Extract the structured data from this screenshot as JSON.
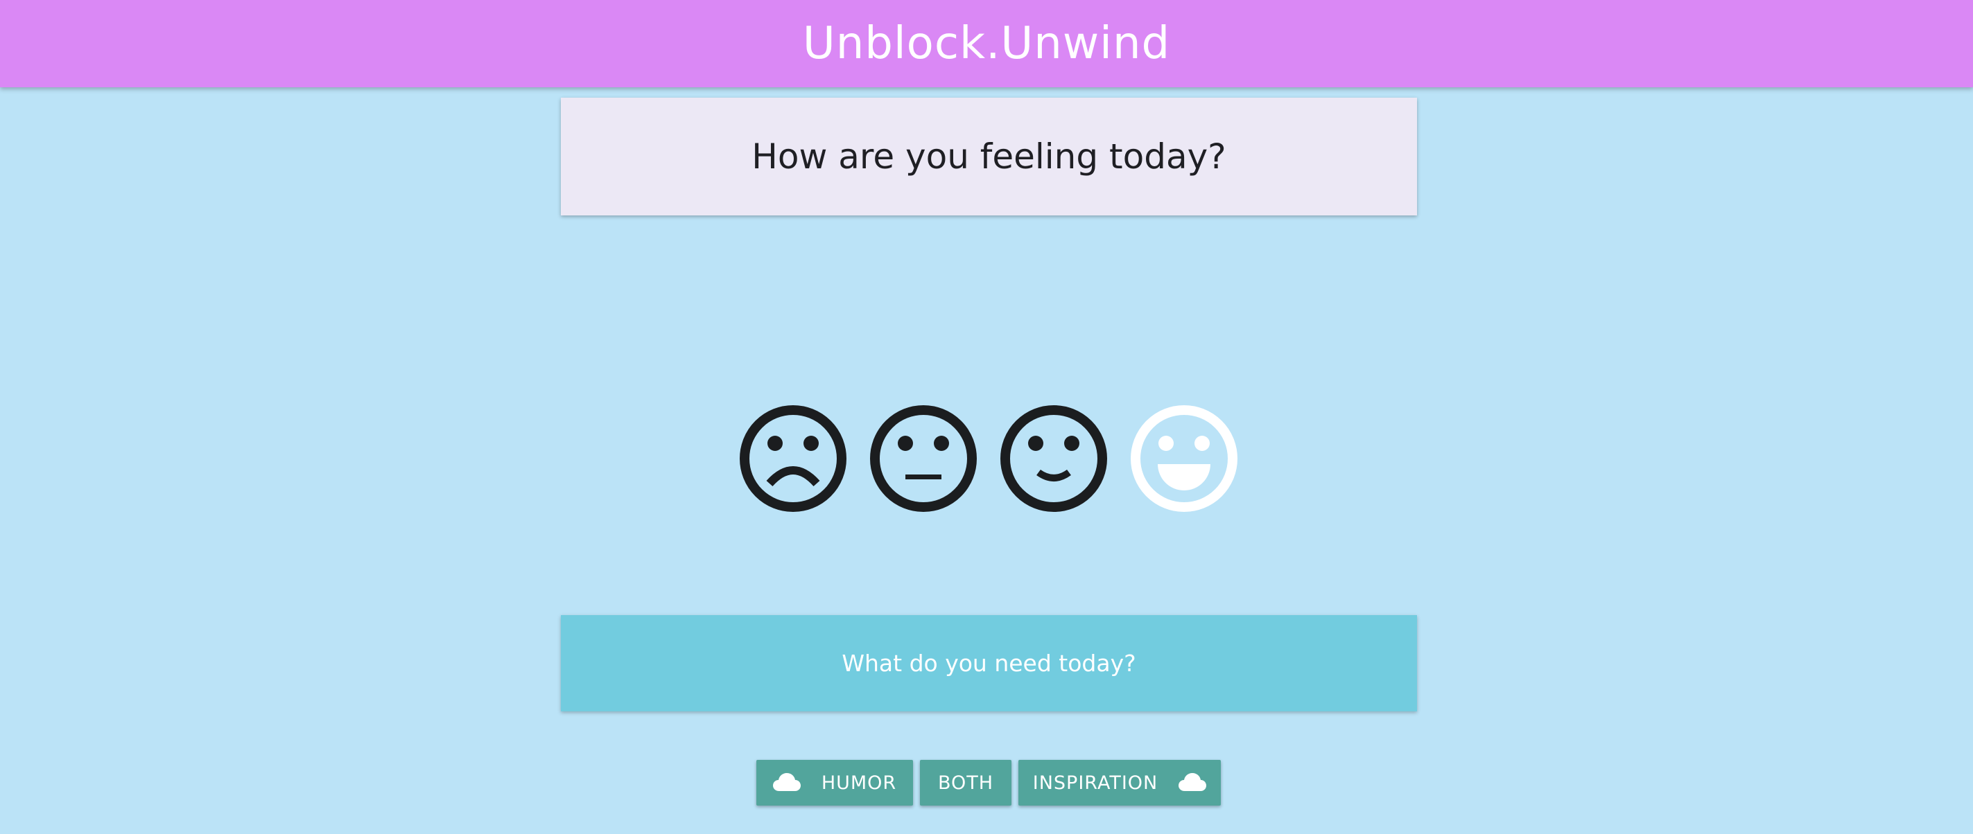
{
  "header": {
    "title": "Unblock.Unwind",
    "background_color": "#da88f5"
  },
  "question": {
    "text": "How are you feeling today?"
  },
  "moods": [
    {
      "name": "sad",
      "icon": "sad-face-icon",
      "selected": false,
      "color": "#1b1d1f"
    },
    {
      "name": "neutral",
      "icon": "neutral-face-icon",
      "selected": false,
      "color": "#1b1d1f"
    },
    {
      "name": "happy",
      "icon": "smile-face-icon",
      "selected": false,
      "color": "#1b1d1f"
    },
    {
      "name": "very-happy",
      "icon": "grin-face-icon",
      "selected": true,
      "color": "#ffffff"
    }
  ],
  "need": {
    "text": "What do you need today?",
    "background_color": "#72ccdf"
  },
  "options": {
    "humor_label": "HUMOR",
    "both_label": "BOTH",
    "inspiration_label": "INSPIRATION",
    "button_color": "#52a59c",
    "icon": "cloud-icon"
  },
  "page_background": "#bbe3f7"
}
